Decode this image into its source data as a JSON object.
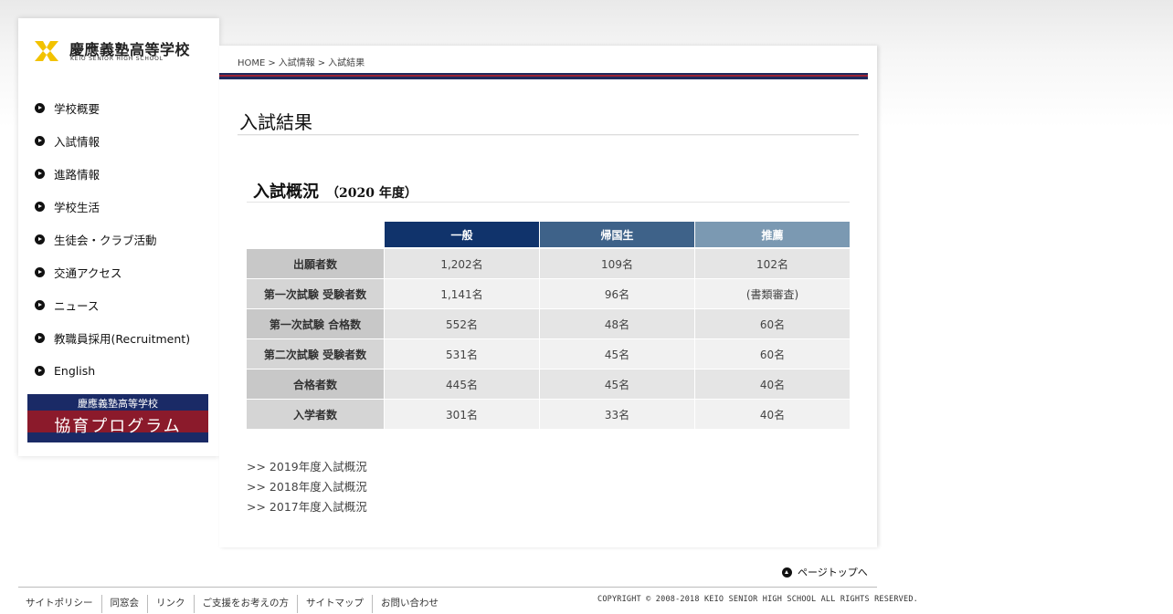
{
  "logo": {
    "name_jp": "慶應義塾高等学校",
    "name_en": "KEIO SENIOR HIGH SCHOOL",
    "mark_color": "#f2c200"
  },
  "nav": {
    "items": [
      {
        "label": "学校概要"
      },
      {
        "label": "入試情報"
      },
      {
        "label": "進路情報"
      },
      {
        "label": "学校生活"
      },
      {
        "label": "生徒会・クラブ活動"
      },
      {
        "label": "交通アクセス"
      },
      {
        "label": "ニュース"
      },
      {
        "label": "教職員採用(Recruitment)"
      },
      {
        "label": "English"
      }
    ]
  },
  "banner": {
    "top_text": "慶應義塾高等学校",
    "main_text": "協育プログラム"
  },
  "breadcrumb": {
    "home": "HOME",
    "sep": ">",
    "level1": "入試情報",
    "level2": "入試結果"
  },
  "page": {
    "title": "入試結果",
    "section_title": "入試概況",
    "section_year": "（2020 年度）"
  },
  "table": {
    "headers": [
      "一般",
      "帰国生",
      "推薦"
    ],
    "header_colors": [
      "#10336b",
      "#3e6289",
      "#7b99b2"
    ],
    "rows": [
      {
        "label": "出願者数",
        "values": [
          "1,202名",
          "109名",
          "102名"
        ]
      },
      {
        "label": "第一次試験 受験者数",
        "values": [
          "1,141名",
          "96名",
          "(書類審査)"
        ]
      },
      {
        "label": "第一次試験 合格数",
        "values": [
          "552名",
          "48名",
          "60名"
        ]
      },
      {
        "label": "第二次試験 受験者数",
        "values": [
          "531名",
          "45名",
          "60名"
        ]
      },
      {
        "label": "合格者数",
        "values": [
          "445名",
          "45名",
          "40名"
        ]
      },
      {
        "label": "入学者数",
        "values": [
          "301名",
          "33名",
          "40名"
        ]
      }
    ]
  },
  "previous": {
    "links": [
      ">> 2019年度入試概況",
      ">> 2018年度入試概況",
      ">> 2017年度入試概況"
    ]
  },
  "footer": {
    "page_top": "ページトップへ",
    "links": [
      "サイトポリシー",
      "同窓会",
      "リンク",
      "ご支援をお考えの方",
      "サイトマップ",
      "お問い合わせ"
    ],
    "copyright": "COPYRIGHT © 2008-2018 KEIO SENIOR HIGH SCHOOL ALL RIGHTS RESERVED."
  }
}
